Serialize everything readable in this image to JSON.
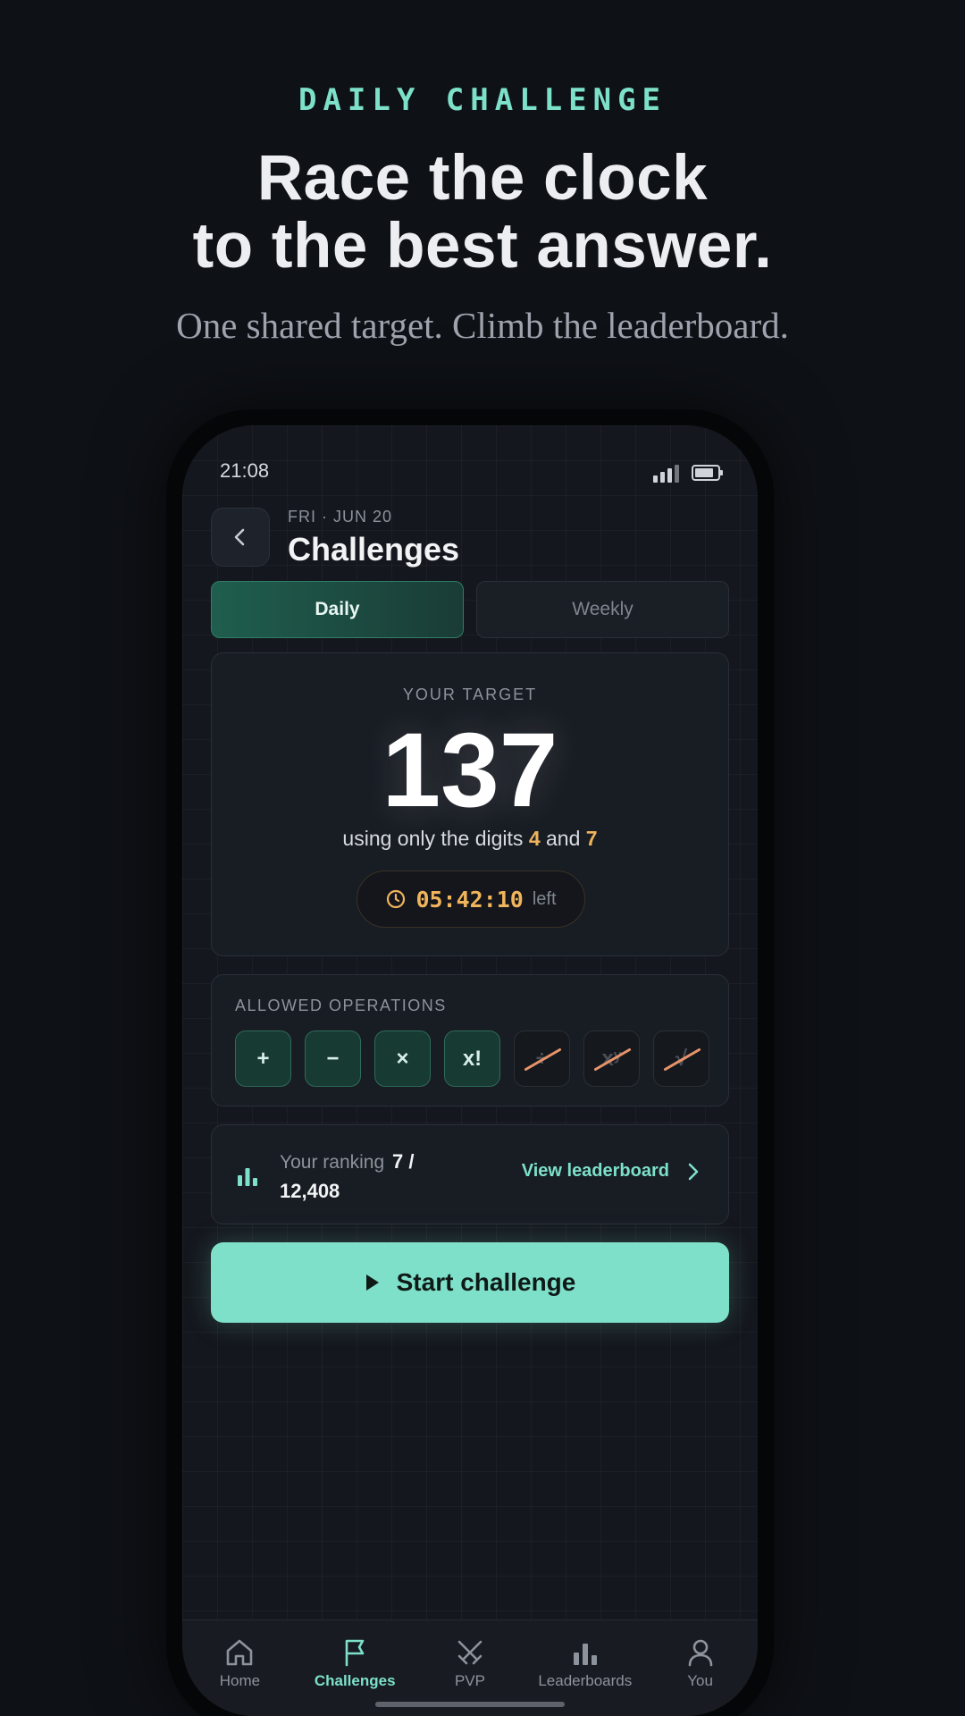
{
  "hero": {
    "eyebrow": "DAILY CHALLENGE",
    "headline_line1": "Race the clock",
    "headline_line2": "to the best answer.",
    "subline": "One shared target. Climb the leaderboard."
  },
  "status": {
    "time": "21:08"
  },
  "header": {
    "date": "FRI · JUN 20",
    "title": "Challenges"
  },
  "tabs": [
    {
      "label": "Daily",
      "active": true
    },
    {
      "label": "Weekly",
      "active": false
    }
  ],
  "target": {
    "label": "YOUR TARGET",
    "value": "137",
    "digits_prefix": "using only the digits",
    "digit1": "4",
    "digits_joiner": "and",
    "digit2": "7",
    "countdown": "05:42:10",
    "countdown_suffix": "left"
  },
  "operations": {
    "label": "ALLOWED OPERATIONS",
    "items": [
      {
        "symbol": "+",
        "allowed": true
      },
      {
        "symbol": "−",
        "allowed": true
      },
      {
        "symbol": "×",
        "allowed": true
      },
      {
        "symbol": "x!",
        "allowed": true
      },
      {
        "symbol": "÷",
        "allowed": false
      },
      {
        "symbol": "xʸ",
        "allowed": false
      },
      {
        "symbol": "√",
        "allowed": false
      }
    ]
  },
  "ranking": {
    "label": "Your ranking",
    "value_line1": "7 /",
    "value_line2": "12,408",
    "link": "View leaderboard"
  },
  "start_button": {
    "label": "Start challenge"
  },
  "nav": [
    {
      "label": "Home",
      "icon": "home-icon",
      "active": false
    },
    {
      "label": "Challenges",
      "icon": "flag-icon",
      "active": true
    },
    {
      "label": "PVP",
      "icon": "crossed-swords-icon",
      "active": false
    },
    {
      "label": "Leaderboards",
      "icon": "bar-chart-icon",
      "active": false
    },
    {
      "label": "You",
      "icon": "user-icon",
      "active": false
    }
  ],
  "colors": {
    "accent": "#7de1c9",
    "highlight": "#f0b45c",
    "disabled_strike": "#e8946a",
    "background": "#0e1116"
  }
}
